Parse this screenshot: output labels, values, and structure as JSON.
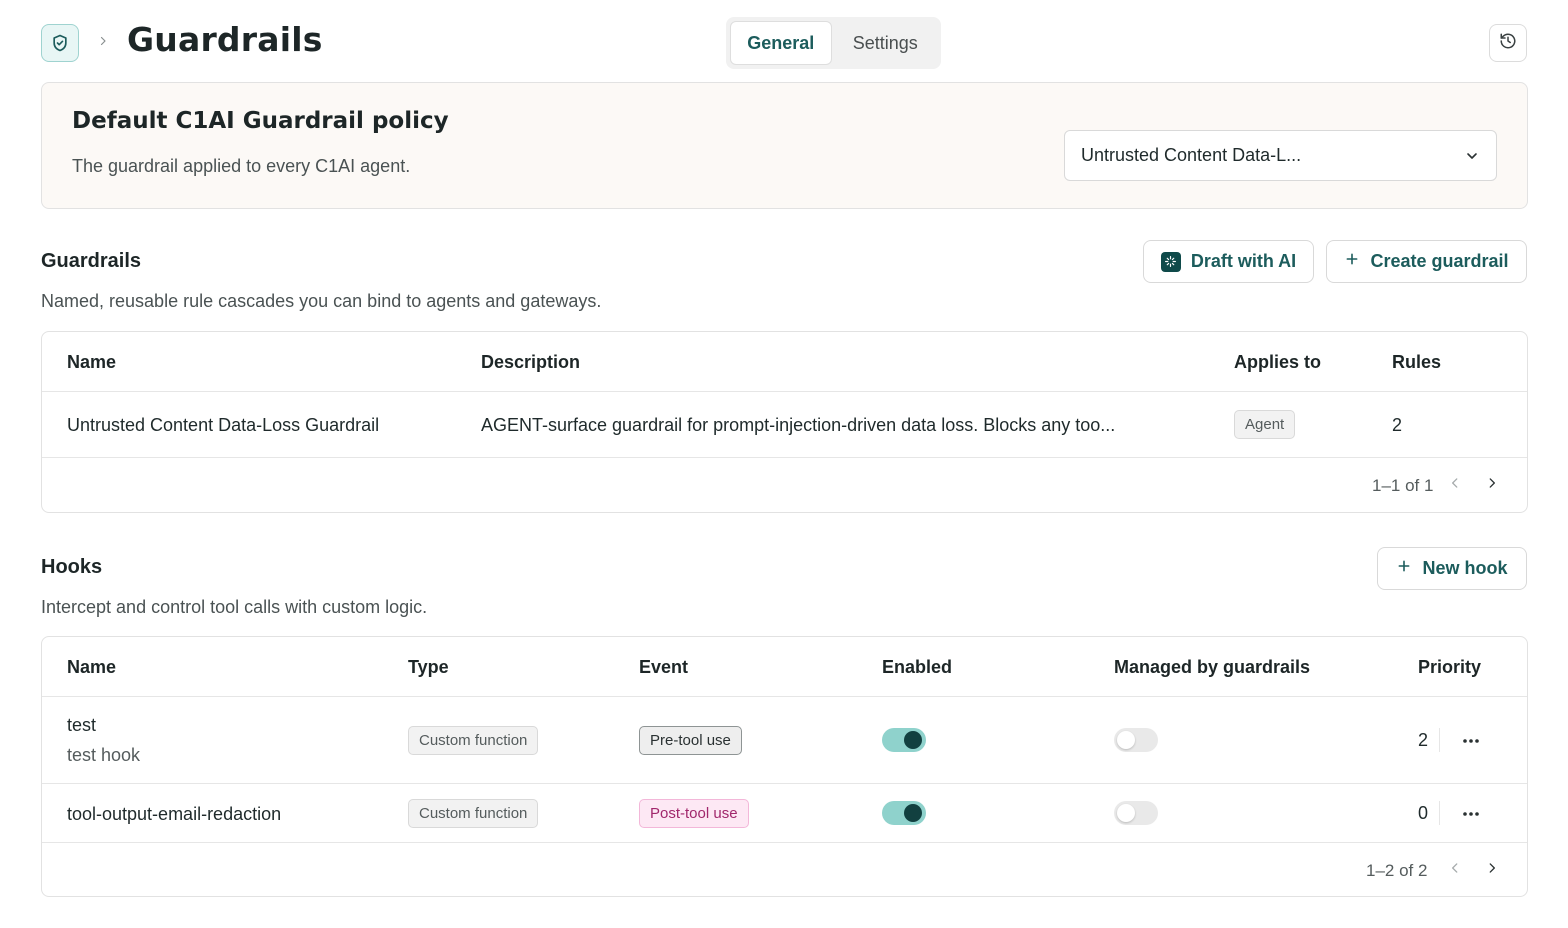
{
  "header": {
    "title": "Guardrails",
    "icons": {
      "app": "shield-check-icon",
      "breadcrumb": "chevron-right-icon",
      "history": "history-icon"
    },
    "tabs": [
      {
        "label": "General",
        "active": true
      },
      {
        "label": "Settings",
        "active": false
      }
    ]
  },
  "policy": {
    "title": "Default C1AI Guardrail policy",
    "description": "The guardrail applied to every C1AI agent.",
    "selected": "Untrusted Content Data-L...",
    "select_icon": "chevron-down-icon"
  },
  "guardrails": {
    "title": "Guardrails",
    "subtitle": "Named, reusable rule cascades you can bind to agents and gateways.",
    "draft_button": "Draft with AI",
    "create_button": "Create guardrail",
    "columns": {
      "name": "Name",
      "description": "Description",
      "applies_to": "Applies to",
      "rules": "Rules"
    },
    "rows": [
      {
        "name": "Untrusted Content Data-Loss Guardrail",
        "description": "AGENT-surface guardrail for prompt-injection-driven data loss. Blocks any too...",
        "applies_to": "Agent",
        "rules": "2"
      }
    ],
    "pagination": "1–1 of 1"
  },
  "hooks": {
    "title": "Hooks",
    "subtitle": "Intercept and control tool calls with custom logic.",
    "new_button": "New hook",
    "columns": {
      "name": "Name",
      "type": "Type",
      "event": "Event",
      "enabled": "Enabled",
      "managed": "Managed by guardrails",
      "priority": "Priority"
    },
    "rows": [
      {
        "name": "test",
        "description": "test hook",
        "type": "Custom function",
        "event": "Pre-tool use",
        "enabled": true,
        "managed": false,
        "priority": "2"
      },
      {
        "name": "tool-output-email-redaction",
        "description": "",
        "type": "Custom function",
        "event": "Post-tool use",
        "enabled": true,
        "managed": false,
        "priority": "0"
      }
    ],
    "pagination": "1–2 of 2"
  },
  "colors": {
    "accent": "#1c5c5c",
    "toggle_on": "#8fd2cc",
    "pink_chip": "#fde8f4"
  }
}
